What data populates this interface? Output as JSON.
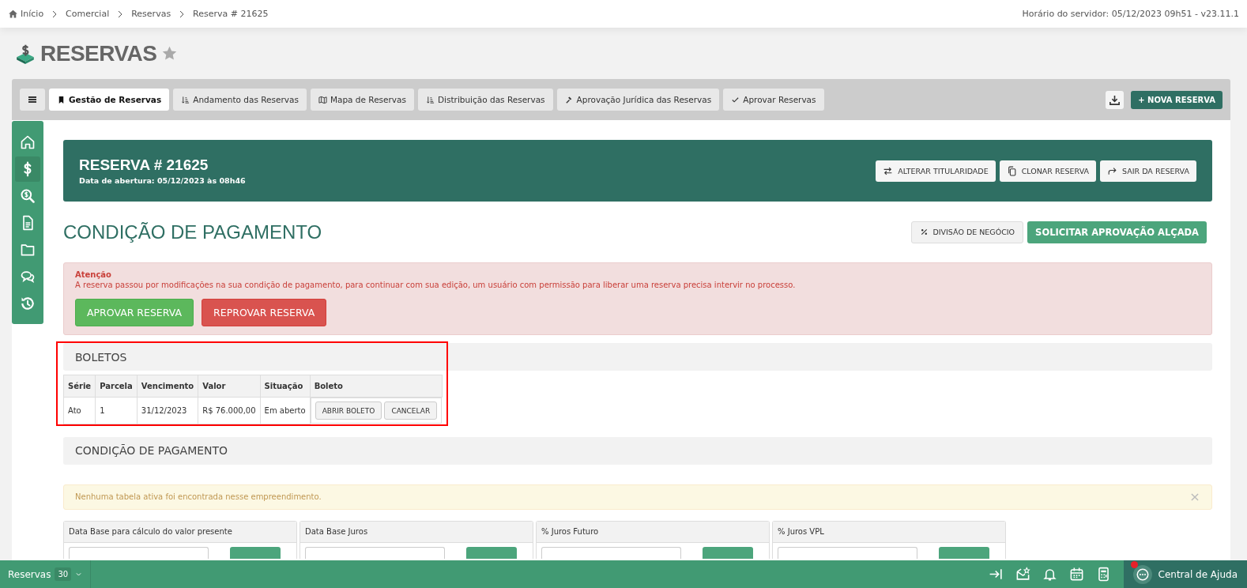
{
  "breadcrumb": [
    {
      "label": "Início",
      "kind": "home"
    },
    {
      "label": "Comercial"
    },
    {
      "label": "Reservas"
    },
    {
      "label": "Reserva # 21625"
    }
  ],
  "server_time": "Horário do servidor: 05/12/2023 09h51 - v23.11.1",
  "page_title": "RESERVAS",
  "favorite": false,
  "tabs": [
    {
      "label": "Gestão de Reservas",
      "kind": "bookmark",
      "selected": true
    },
    {
      "label": "Andamento das Reservas",
      "kind": "sort",
      "selected": false
    },
    {
      "label": "Mapa de Reservas",
      "kind": "map",
      "selected": false
    },
    {
      "label": "Distribuição das Reservas",
      "kind": "sort",
      "selected": false
    },
    {
      "label": "Aprovação Jurídica das Reservas",
      "kind": "gavel",
      "selected": false
    },
    {
      "label": "Aprovar Reservas",
      "kind": "check",
      "selected": false
    }
  ],
  "new_button": "+ NOVA RESERVA",
  "sidebar": [
    {
      "kind": "home",
      "selected": false
    },
    {
      "kind": "dollar",
      "selected": true
    },
    {
      "kind": "search-dollar",
      "selected": false
    },
    {
      "kind": "document",
      "selected": false
    },
    {
      "kind": "folder",
      "selected": false
    },
    {
      "kind": "chat",
      "selected": false
    },
    {
      "kind": "history",
      "selected": false
    }
  ],
  "reservation": {
    "title": "RESERVA # 21625",
    "subtitle": "Data de abertura: 05/12/2023 às 08h46",
    "actions": [
      {
        "label": "ALTERAR TITULARIDADE",
        "kind": "swap"
      },
      {
        "label": "CLONAR RESERVA",
        "kind": "copy"
      },
      {
        "label": "SAIR DA RESERVA",
        "kind": "share"
      }
    ]
  },
  "section_title": "CONDIÇÃO DE PAGAMENTO",
  "section_actions": [
    {
      "label": "DIVISÃO DE NEGÓCIO",
      "kind": "default"
    },
    {
      "label": "SOLICITAR APROVAÇÃO ALÇADA",
      "kind": "success"
    }
  ],
  "alert": {
    "title": "Atenção",
    "text": "A reserva passou por modificações na sua condição de pagamento, para continuar com sua edição, um usuário com permissão para liberar uma reserva precisa intervir no processo.",
    "buttons": [
      {
        "label": "APROVAR RESERVA",
        "kind": "approve"
      },
      {
        "label": "REPROVAR RESERVA",
        "kind": "reject"
      }
    ]
  },
  "boletos": {
    "title": "BOLETOS",
    "highlighted": true,
    "columns": [
      "Série",
      "Parcela",
      "Vencimento",
      "Valor",
      "Situação",
      "Boleto"
    ],
    "rows": [
      {
        "cells": [
          "Ato",
          "1",
          "31/12/2023",
          "R$ 76.000,00",
          "Em aberto"
        ],
        "buttons": [
          "ABRIR BOLETO",
          "CANCELAR"
        ]
      }
    ]
  },
  "payment_title": "CONDIÇÃO DE PAGAMENTO",
  "warning": {
    "text": "Nenhuma tabela ativa foi encontrada nesse empreendimento.",
    "dismissible": true
  },
  "settings": [
    {
      "label": "Data Base para cálculo do valor presente"
    },
    {
      "label": "Data Base Juros"
    },
    {
      "label": "% Juros Futuro"
    },
    {
      "label": "% Juros VPL"
    }
  ],
  "bottom_bar": {
    "label": "Reservas",
    "count": "30",
    "help": "Central de Ajuda",
    "help_notification": true
  }
}
